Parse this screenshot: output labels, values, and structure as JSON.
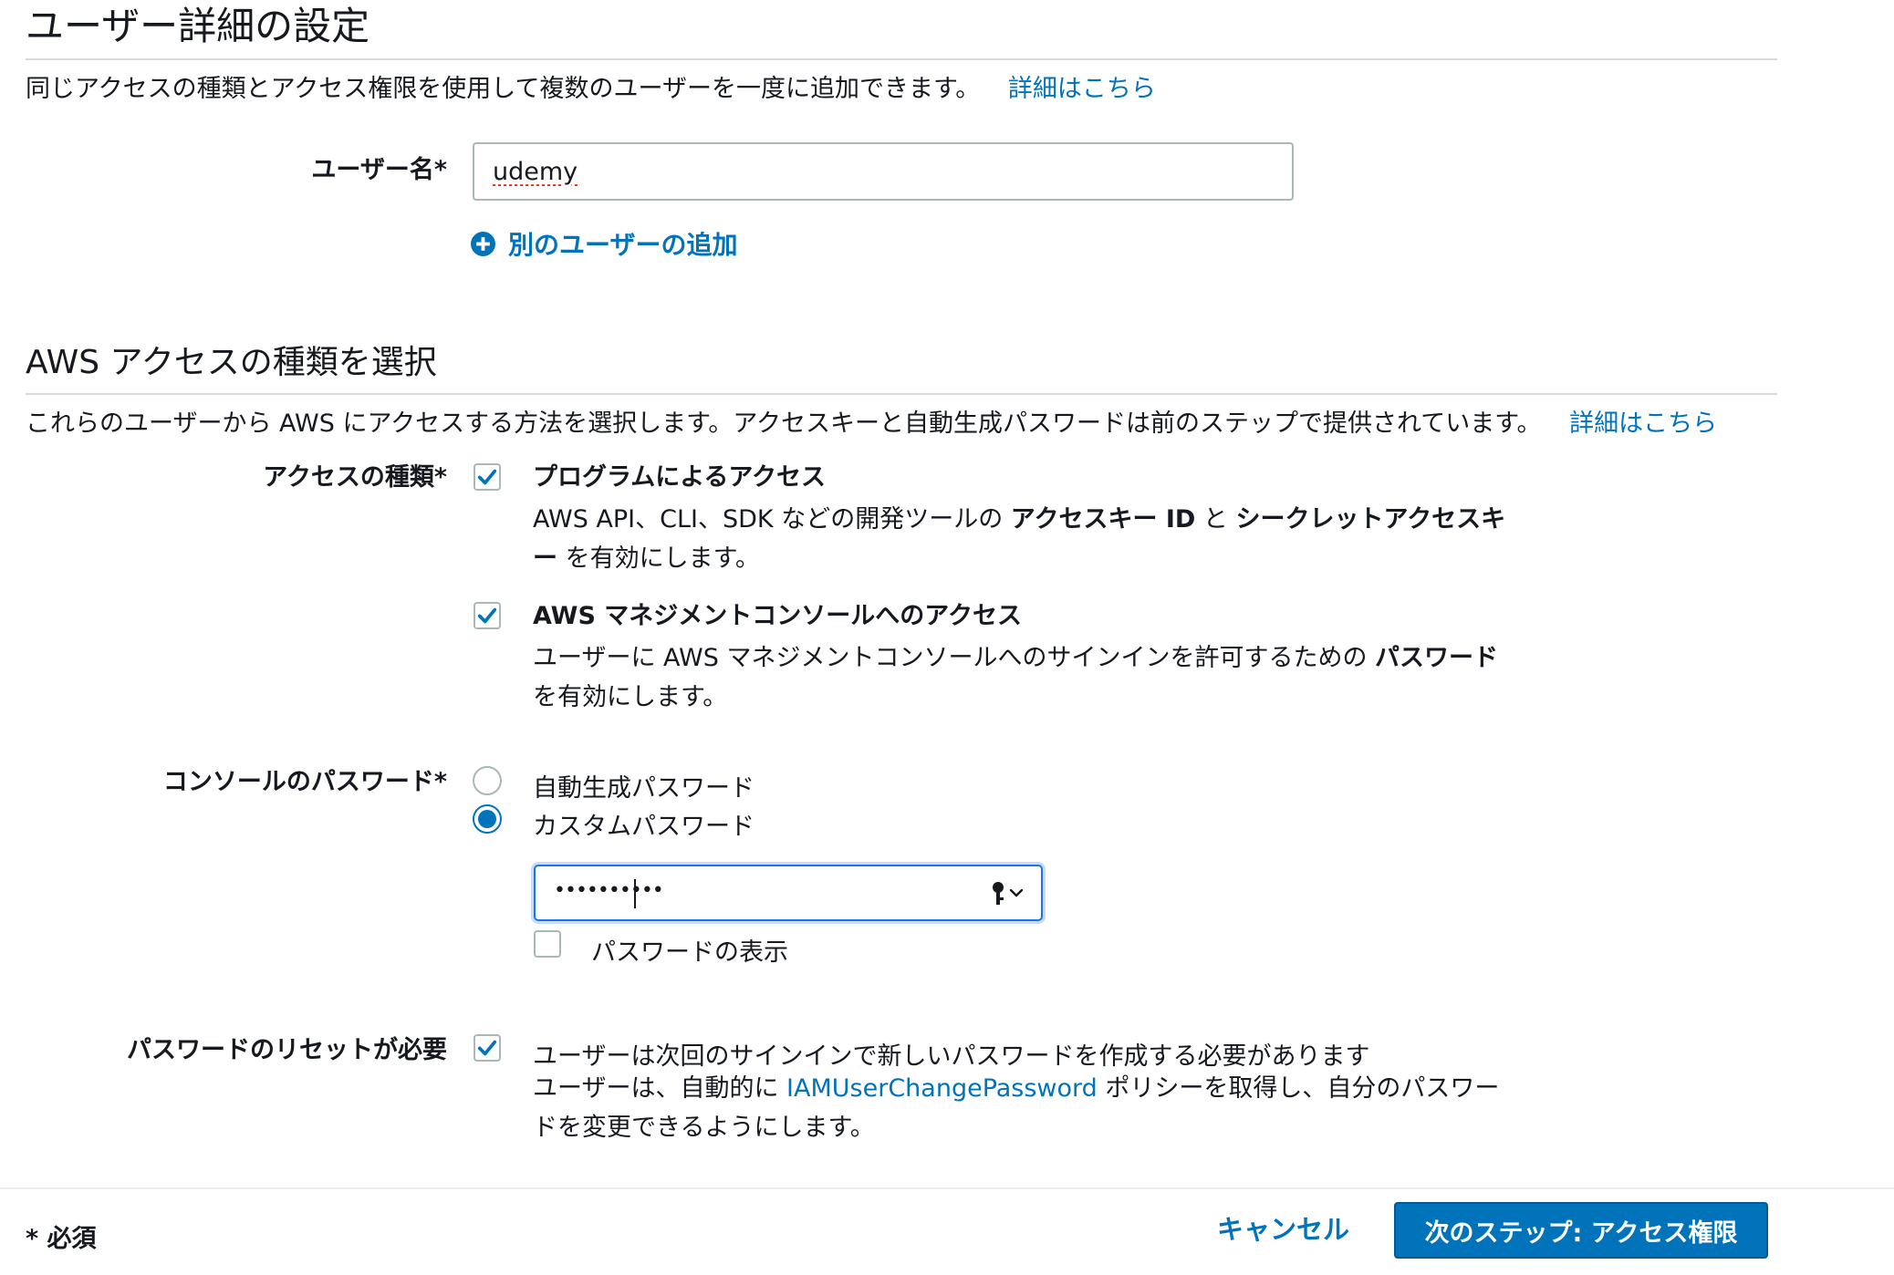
{
  "user_details": {
    "title": "ユーザー詳細の設定",
    "description": "同じアクセスの種類とアクセス権限を使用して複数のユーザーを一度に追加できます。",
    "learn_more": "詳細はこちら",
    "username_label": "ユーザー名*",
    "username_value": "udemy",
    "add_user_link": "別のユーザーの追加"
  },
  "access_type_section": {
    "title": "AWS アクセスの種類を選択",
    "description": "これらのユーザーから AWS にアクセスする方法を選択します。アクセスキーと自動生成パスワードは前のステップで提供されています。",
    "learn_more": "詳細はこちら",
    "access_type_label": "アクセスの種類*",
    "programmatic": {
      "checked": true,
      "title": "プログラムによるアクセス",
      "desc_part1": "AWS API、CLI、SDK などの開発ツールの ",
      "desc_bold1": "アクセスキー ID",
      "desc_part2": " と ",
      "desc_bold2": "シークレットアクセスキ",
      "desc_bold3": "ー",
      "desc_part3": " を有効にします。"
    },
    "console": {
      "checked": true,
      "title": "AWS マネジメントコンソールへのアクセス",
      "desc_part1": "ユーザーに AWS マネジメントコンソールへのサインインを許可するための ",
      "desc_bold1": "パスワード",
      "desc_part2": "を有効にします。"
    },
    "console_password_label": "コンソールのパスワード*",
    "password_options": [
      {
        "label": "自動生成パスワード",
        "selected": false
      },
      {
        "label": "カスタムパスワード",
        "selected": true
      }
    ],
    "password_masked": "••••••••••",
    "show_password_label": "パスワードの表示",
    "show_password_checked": false,
    "reset_label": "パスワードのリセットが必要",
    "reset_checked": true,
    "reset_title": "ユーザーは次回のサインインで新しいパスワードを作成する必要があります",
    "reset_desc_part1": "ユーザーは、自動的に ",
    "reset_desc_link": "IAMUserChangePassword",
    "reset_desc_part2": " ポリシーを取得し、自分のパスワー",
    "reset_desc_part3": "ドを変更できるようにします。"
  },
  "footer": {
    "required_note": "* 必須",
    "cancel_label": "キャンセル",
    "next_label": "次のステップ: アクセス権限"
  },
  "icons": {
    "check": "check-icon",
    "plus_circle": "plus-circle-icon",
    "key": "key-icon",
    "chevron": "chevron-down-icon"
  },
  "colors": {
    "accent": "#0073bb",
    "text": "#16191f",
    "border": "#aab7b8",
    "focus": "#1a73e8"
  }
}
